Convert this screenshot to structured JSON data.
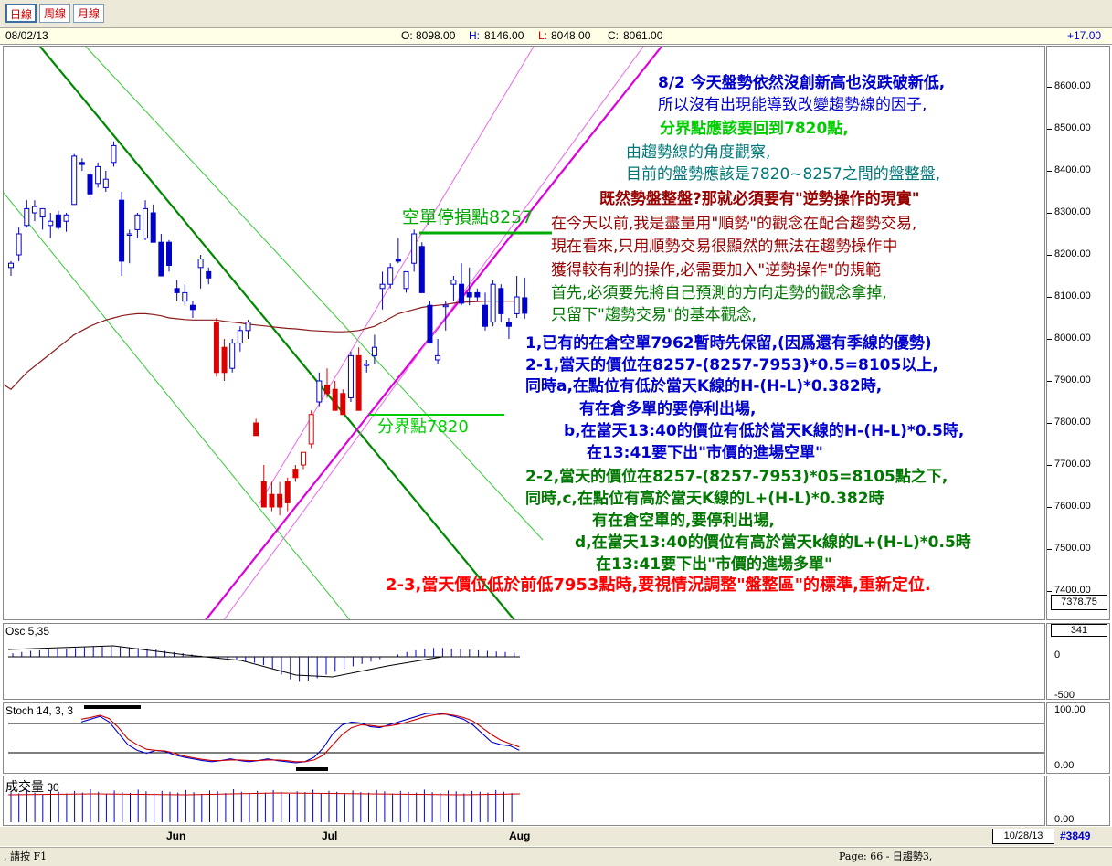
{
  "toolbar": {
    "tabs": [
      "日線",
      "周線",
      "月線"
    ]
  },
  "infobar": {
    "date": "08/02/13",
    "o_label": "O:",
    "o_value": "8098.00",
    "h_label": "H:",
    "h_value": "8146.00",
    "l_label": "L:",
    "l_value": "8048.00",
    "c_label": "C:",
    "c_value": "8061.00",
    "change": "+17.00"
  },
  "colors": {
    "up_candle": "#0000cc",
    "down_candle": "#dd0000",
    "ma_line": "#8b1a1a",
    "trend_green": "#008800",
    "trend_magenta": "#dd00dd",
    "ann_blue": "#0000cc",
    "ann_green": "#00cc00",
    "ann_teal": "#007777",
    "ann_darkred": "#990000",
    "ann_dkgreen": "#007700",
    "ann_red": "#ff0000"
  },
  "chart_data": [
    {
      "type": "candlestick",
      "title": "",
      "ylim": [
        7350,
        8700
      ],
      "y_ticks": [
        "8600.00",
        "8500.00",
        "8400.00",
        "8300.00",
        "8200.00",
        "8100.00",
        "8000.00",
        "7900.00",
        "7800.00",
        "7700.00",
        "7600.00",
        "7500.00",
        "7400.00"
      ],
      "last_price_tag": "7378.75",
      "x_labels": [
        "Jun",
        "Jul",
        "Aug"
      ],
      "candles": [
        {
          "o": 8170,
          "h": 8185,
          "l": 8150,
          "c": 8180
        },
        {
          "o": 8200,
          "h": 8265,
          "l": 8185,
          "c": 8250
        },
        {
          "o": 8270,
          "h": 8330,
          "l": 8265,
          "c": 8310
        },
        {
          "o": 8300,
          "h": 8330,
          "l": 8280,
          "c": 8315
        },
        {
          "o": 8290,
          "h": 8310,
          "l": 8260,
          "c": 8310
        },
        {
          "o": 8270,
          "h": 8300,
          "l": 8240,
          "c": 8280
        },
        {
          "o": 8295,
          "h": 8305,
          "l": 8260,
          "c": 8265
        },
        {
          "o": 8280,
          "h": 8300,
          "l": 8255,
          "c": 8295
        },
        {
          "o": 8320,
          "h": 8440,
          "l": 8320,
          "c": 8435
        },
        {
          "o": 8420,
          "h": 8430,
          "l": 8400,
          "c": 8415
        },
        {
          "o": 8390,
          "h": 8400,
          "l": 8330,
          "c": 8345
        },
        {
          "o": 8370,
          "h": 8420,
          "l": 8360,
          "c": 8410
        },
        {
          "o": 8360,
          "h": 8400,
          "l": 8350,
          "c": 8380
        },
        {
          "o": 8420,
          "h": 8470,
          "l": 8410,
          "c": 8460
        },
        {
          "o": 8330,
          "h": 8350,
          "l": 8150,
          "c": 8185
        },
        {
          "o": 8250,
          "h": 8260,
          "l": 8180,
          "c": 8250
        },
        {
          "o": 8260,
          "h": 8300,
          "l": 8240,
          "c": 8295
        },
        {
          "o": 8240,
          "h": 8330,
          "l": 8235,
          "c": 8310
        },
        {
          "o": 8300,
          "h": 8320,
          "l": 8230,
          "c": 8230
        },
        {
          "o": 8230,
          "h": 8250,
          "l": 8150,
          "c": 8150
        },
        {
          "o": 8230,
          "h": 8235,
          "l": 8160,
          "c": 8175
        },
        {
          "o": 8120,
          "h": 8140,
          "l": 8090,
          "c": 8110
        },
        {
          "o": 8090,
          "h": 8130,
          "l": 8080,
          "c": 8110
        },
        {
          "o": 8080,
          "h": 8090,
          "l": 8050,
          "c": 8070
        },
        {
          "o": 8170,
          "h": 8200,
          "l": 8120,
          "c": 8190
        },
        {
          "o": 8160,
          "h": 8170,
          "l": 8130,
          "c": 8145
        },
        {
          "o": 8040,
          "h": 8050,
          "l": 7910,
          "c": 7920
        },
        {
          "o": 7980,
          "h": 8000,
          "l": 7900,
          "c": 7920
        },
        {
          "o": 7930,
          "h": 8000,
          "l": 7920,
          "c": 7990
        },
        {
          "o": 7990,
          "h": 8030,
          "l": 7970,
          "c": 8020
        },
        {
          "o": 8020,
          "h": 8045,
          "l": 8000,
          "c": 8040
        },
        {
          "o": 7800,
          "h": 7810,
          "l": 7770,
          "c": 7770
        },
        {
          "o": 7660,
          "h": 7700,
          "l": 7600,
          "c": 7600
        },
        {
          "o": 7630,
          "h": 7660,
          "l": 7590,
          "c": 7600
        },
        {
          "o": 7630,
          "h": 7660,
          "l": 7580,
          "c": 7600
        },
        {
          "o": 7660,
          "h": 7670,
          "l": 7590,
          "c": 7610
        },
        {
          "o": 7690,
          "h": 7700,
          "l": 7660,
          "c": 7670
        },
        {
          "o": 7700,
          "h": 7730,
          "l": 7690,
          "c": 7730
        },
        {
          "o": 7750,
          "h": 7830,
          "l": 7740,
          "c": 7820
        },
        {
          "o": 7850,
          "h": 7920,
          "l": 7840,
          "c": 7900
        },
        {
          "o": 7890,
          "h": 7930,
          "l": 7860,
          "c": 7870
        },
        {
          "o": 7880,
          "h": 7900,
          "l": 7830,
          "c": 7830
        },
        {
          "o": 7870,
          "h": 7880,
          "l": 7820,
          "c": 7820
        },
        {
          "o": 7860,
          "h": 7970,
          "l": 7850,
          "c": 7960
        },
        {
          "o": 7960,
          "h": 7980,
          "l": 7830,
          "c": 7830
        },
        {
          "o": 7940,
          "h": 7950,
          "l": 7920,
          "c": 7940
        },
        {
          "o": 7960,
          "h": 8010,
          "l": 7940,
          "c": 7980
        },
        {
          "o": 8120,
          "h": 8160,
          "l": 8070,
          "c": 8130
        },
        {
          "o": 8130,
          "h": 8180,
          "l": 8120,
          "c": 8170
        },
        {
          "o": 8190,
          "h": 8240,
          "l": 8180,
          "c": 8185
        },
        {
          "o": 8120,
          "h": 8160,
          "l": 8110,
          "c": 8160
        },
        {
          "o": 8180,
          "h": 8260,
          "l": 8160,
          "c": 8250
        },
        {
          "o": 8220,
          "h": 8230,
          "l": 8110,
          "c": 8110
        },
        {
          "o": 8080,
          "h": 8090,
          "l": 7990,
          "c": 7990
        },
        {
          "o": 7950,
          "h": 8000,
          "l": 7940,
          "c": 7960
        },
        {
          "o": 8080,
          "h": 8090,
          "l": 8020,
          "c": 8080
        },
        {
          "o": 8130,
          "h": 8150,
          "l": 8090,
          "c": 8140
        },
        {
          "o": 8130,
          "h": 8180,
          "l": 8080,
          "c": 8085
        },
        {
          "o": 8110,
          "h": 8170,
          "l": 8080,
          "c": 8100
        },
        {
          "o": 8110,
          "h": 8120,
          "l": 8090,
          "c": 8100
        },
        {
          "o": 8080,
          "h": 8110,
          "l": 8020,
          "c": 8030
        },
        {
          "o": 8040,
          "h": 8140,
          "l": 8030,
          "c": 8130
        },
        {
          "o": 8120,
          "h": 8130,
          "l": 8040,
          "c": 8060
        },
        {
          "o": 8040,
          "h": 8050,
          "l": 8000,
          "c": 8030
        },
        {
          "o": 8060,
          "h": 8150,
          "l": 8050,
          "c": 8100
        },
        {
          "o": 8098,
          "h": 8146,
          "l": 8048,
          "c": 8061
        }
      ],
      "ma": [
        7880,
        7900,
        7920,
        7935,
        7950,
        7965,
        7980,
        7995,
        8010,
        8020,
        8030,
        8038,
        8045,
        8050,
        8055,
        8058,
        8060,
        8060,
        8058,
        8055,
        8050,
        8048,
        8046,
        8045,
        8045,
        8045,
        8045,
        8042,
        8040,
        8038,
        8035,
        8033,
        8031,
        8029,
        8027,
        8025,
        8024,
        8022,
        8020,
        8019,
        8018,
        8017,
        8017,
        8018,
        8020,
        8025,
        8030,
        8040,
        8050,
        8060,
        8065,
        8070,
        8075,
        8078,
        8080,
        8082,
        8085,
        8087,
        8088,
        8089,
        8090,
        8090,
        8090,
        8090,
        8090
      ]
    },
    {
      "type": "bar",
      "title": "Osc 5,35",
      "y_ticks": [
        "341",
        "0",
        "-500"
      ],
      "ylim": [
        -500,
        400
      ],
      "values": [
        60,
        80,
        100,
        110,
        120,
        130,
        140,
        150,
        160,
        170,
        175,
        170,
        165,
        160,
        150,
        140,
        120,
        100,
        80,
        60,
        40,
        20,
        0,
        -20,
        -40,
        -60,
        -80,
        -100,
        -140,
        -200,
        -300,
        -380,
        -420,
        -400,
        -360,
        -300,
        -250,
        -200,
        -160,
        -120,
        -80,
        -40,
        0,
        40,
        80,
        110,
        140,
        150,
        150,
        140,
        130,
        120,
        110,
        100,
        90,
        80,
        70
      ]
    },
    {
      "type": "line",
      "title": "Stoch 14, 3, 3",
      "y_ticks": [
        "100.00",
        "0.00"
      ],
      "ylim": [
        0,
        100
      ],
      "series": [
        {
          "values": [
            80,
            85,
            90,
            80,
            60,
            40,
            30,
            25,
            30,
            28,
            22,
            18,
            15,
            12,
            10,
            12,
            15,
            12,
            10,
            12,
            15,
            12,
            10,
            8,
            10,
            18,
            35,
            60,
            75,
            80,
            78,
            72,
            70,
            75,
            80,
            85,
            90,
            95,
            96,
            94,
            90,
            85,
            75,
            60,
            45,
            40,
            38,
            30
          ]
        },
        {
          "values": [
            85,
            88,
            92,
            86,
            70,
            50,
            40,
            32,
            30,
            29,
            25,
            20,
            17,
            14,
            12,
            12,
            13,
            13,
            12,
            12,
            13,
            13,
            12,
            10,
            10,
            13,
            22,
            40,
            58,
            70,
            75,
            74,
            72,
            73,
            76,
            80,
            85,
            90,
            93,
            94,
            92,
            88,
            82,
            70,
            58,
            48,
            42,
            36
          ]
        }
      ]
    },
    {
      "type": "bar",
      "title": "成交量",
      "subtitle": "30",
      "y_ticks": [
        "0.00"
      ],
      "values": [
        75,
        70,
        80,
        72,
        68,
        78,
        74,
        70,
        76,
        72,
        80,
        74,
        69,
        77,
        73,
        71,
        79,
        75,
        70,
        76,
        74,
        72,
        78,
        73,
        69,
        77,
        75,
        71,
        80,
        74,
        70,
        76,
        72,
        78,
        74,
        69,
        75,
        73,
        79,
        71,
        76,
        74,
        70,
        77,
        73,
        72,
        78,
        75,
        70,
        76,
        74,
        72,
        79,
        73,
        71,
        77,
        75,
        70,
        76,
        74,
        72,
        78,
        74,
        71
      ]
    }
  ],
  "labels": {
    "stop_loss": "空單停損點8257",
    "pivot": "分界點7820"
  },
  "annotations": [
    {
      "text": "8/2 今天盤勢依然沒創新高也沒跌破新低,",
      "color": "ann_blue"
    },
    {
      "text": "所以沒有出現能導致改變趨勢線的因子,",
      "color": "ann_blue"
    },
    {
      "text": "分界點應該要回到7820點,",
      "color": "ann_green"
    },
    {
      "text": "由趨勢線的角度觀察,",
      "color": "ann_teal"
    },
    {
      "text": "目前的盤勢應該是7820~8257之間的盤整盤,",
      "color": "ann_teal"
    },
    {
      "text": "既然勢盤整盤?那就必須要有\"逆勢操作的現實\"",
      "color": "ann_darkred"
    },
    {
      "text": "在今天以前,我是盡量用\"順勢\"的觀念在配合趨勢交易,",
      "color": "ann_darkred"
    },
    {
      "text": "現在看來,只用順勢交易很顯然的無法在趨勢操作中",
      "color": "ann_darkred"
    },
    {
      "text": "獲得較有利的操作,必需要加入\"逆勢操作\"的規範",
      "color": "ann_darkred"
    },
    {
      "text": "首先,必須要先將自己預測的方向走勢的觀念拿掉,",
      "color": "ann_dkgreen"
    },
    {
      "text": "只留下\"趨勢交易\"的基本觀念,",
      "color": "ann_dkgreen"
    },
    {
      "text": "1,已有的在倉空單7962暫時先保留,(因爲還有季線的優勢)",
      "color": "ann_blue"
    },
    {
      "text": "2-1,當天的價位在8257-(8257-7953)*0.5=8105以上,",
      "color": "ann_blue"
    },
    {
      "text": "同時a,在點位有低於當天K線的H-(H-L)*0.382時,",
      "color": "ann_blue"
    },
    {
      "text": "有在倉多單的要停利出場,",
      "color": "ann_blue"
    },
    {
      "text": "b,在當天13:40的價位有低於當天K線的H-(H-L)*0.5時,",
      "color": "ann_blue"
    },
    {
      "text": "在13:41要下出\"市價的進場空單\"",
      "color": "ann_blue"
    },
    {
      "text": "2-2,當天的價位在8257-(8257-7953)*05=8105點之下,",
      "color": "ann_dkgreen"
    },
    {
      "text": "同時,c,在點位有高於當天K線的L+(H-L)*0.382時",
      "color": "ann_dkgreen"
    },
    {
      "text": "有在倉空單的,要停利出場,",
      "color": "ann_dkgreen"
    },
    {
      "text": "d,在當天13:40的價位有高於當天k線的L+(H-L)*0.5時",
      "color": "ann_dkgreen"
    },
    {
      "text": "在13:41要下出\"市價的進場多單\"",
      "color": "ann_dkgreen"
    },
    {
      "text": "2-3,當天價位低於前低7953點時,要視情況調整\"盤整區\"的標準,重新定位.",
      "color": "ann_red"
    }
  ],
  "footer": {
    "date_box": "10/28/13",
    "count": "#3849",
    "status_left": ", 請按 F1",
    "status_page": "Page: 66 - 日趨勢3,"
  }
}
